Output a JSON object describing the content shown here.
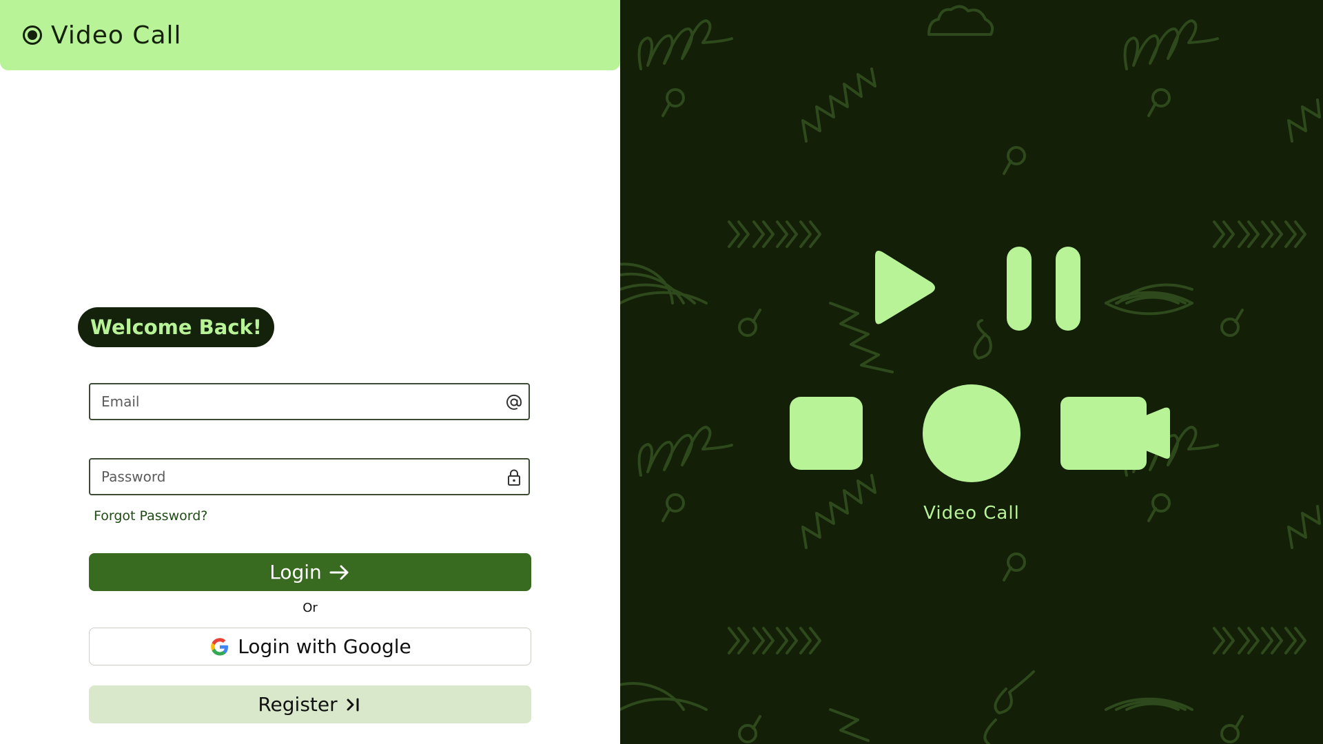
{
  "app": {
    "title": "Video Call"
  },
  "form": {
    "welcome": "Welcome Back!",
    "email_placeholder": "Email",
    "password_placeholder": "Password",
    "forgot": "Forgot Password?",
    "login_label": "Login",
    "or_label": "Or",
    "google_label": "Login with Google",
    "register_label": "Register"
  },
  "hero": {
    "caption": "Video Call",
    "icons": [
      "play-icon",
      "pause-icon",
      "stop-icon",
      "record-icon",
      "video-camera-icon"
    ]
  },
  "icons": {
    "brand": "record-icon",
    "email": "at-sign-icon",
    "password": "lock-icon",
    "login": "arrow-right-icon",
    "google": "google-icon",
    "register": "skip-forward-icon"
  },
  "colors": {
    "accent_light": "#b8f397",
    "accent_dark": "#14220b",
    "login_button": "#386a1f",
    "register_button": "#d9e8ca",
    "right_panel_bg": "#131f07",
    "pattern": "#2e4a1c"
  }
}
